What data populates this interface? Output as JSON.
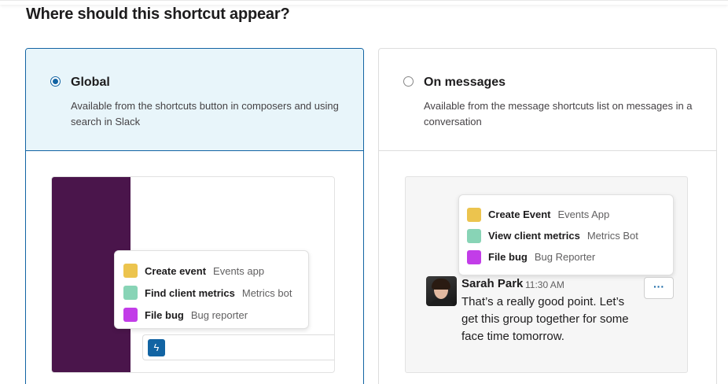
{
  "heading": "Where should this shortcut appear?",
  "options": {
    "global": {
      "title": "Global",
      "description": "Available from the shortcuts button in composers and using search in Slack",
      "selected": true,
      "menu": [
        {
          "name": "Create event",
          "app": "Events app",
          "color": "#ecc44e"
        },
        {
          "name": "Find client metrics",
          "app": "Metrics bot",
          "color": "#88d4b6"
        },
        {
          "name": "File bug",
          "app": "Bug reporter",
          "color": "#c23de8"
        }
      ],
      "composer_icon": "lightning-bolt-icon"
    },
    "messages": {
      "title": "On messages",
      "description": "Available from the message shortcuts list on messages in a conversation",
      "selected": false,
      "menu": [
        {
          "name": "Create Event",
          "app": "Events App",
          "color": "#ecc44e"
        },
        {
          "name": "View client metrics",
          "app": "Metrics Bot",
          "color": "#88d4b6"
        },
        {
          "name": "File bug",
          "app": "Bug Reporter",
          "color": "#c23de8"
        }
      ],
      "message": {
        "author": "Sarah Park",
        "time": "11:30 AM",
        "text": "That’s a really good point. Let’s get this group together for some face time tomorrow."
      },
      "more_actions_label": "···"
    }
  },
  "colors": {
    "accent": "#1264a3",
    "sidebar": "#4a154b",
    "selected_bg": "#e8f5fa"
  }
}
